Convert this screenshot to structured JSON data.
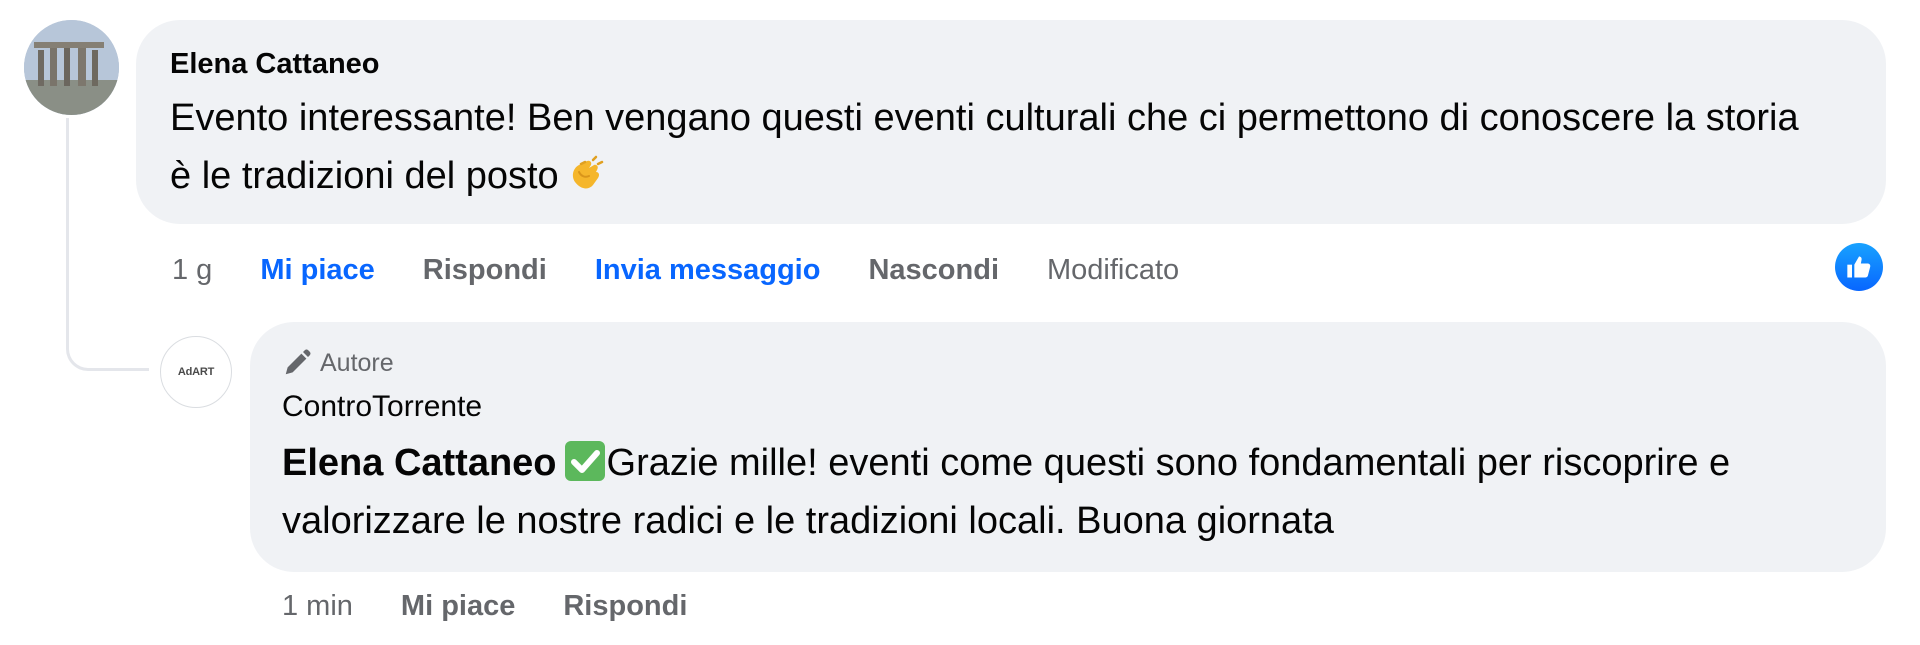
{
  "colors": {
    "bubble_bg": "#f0f2f5",
    "link_blue": "#0866ff",
    "secondary_text": "#65676b",
    "primary_text": "#050505",
    "check_green": "#5cb85c"
  },
  "comment": {
    "author": "Elena Cattaneo",
    "text": "Evento interessante! Ben vengano questi eventi culturali che ci permettono di conoscere la storia è le tradizioni del posto",
    "emoji": "clapping-hands",
    "actions": {
      "time": "1 g",
      "like": "Mi piace",
      "reply": "Rispondi",
      "message": "Invia messaggio",
      "hide": "Nascondi",
      "edited": "Modificato"
    },
    "reaction_icon": "like-icon"
  },
  "reply": {
    "avatar_label": "AdART",
    "badge": "Autore",
    "badge_icon": "pencil-icon",
    "page_name": "ControTorrente",
    "mention": "Elena Cattaneo",
    "text": "Grazie mille! eventi come questi sono fondamentali per riscoprire e valorizzare le nostre radici e le tradizioni locali. Buona giornata",
    "emoji": "check-mark-button",
    "actions": {
      "time": "1 min",
      "like": "Mi piace",
      "reply": "Rispondi"
    }
  }
}
